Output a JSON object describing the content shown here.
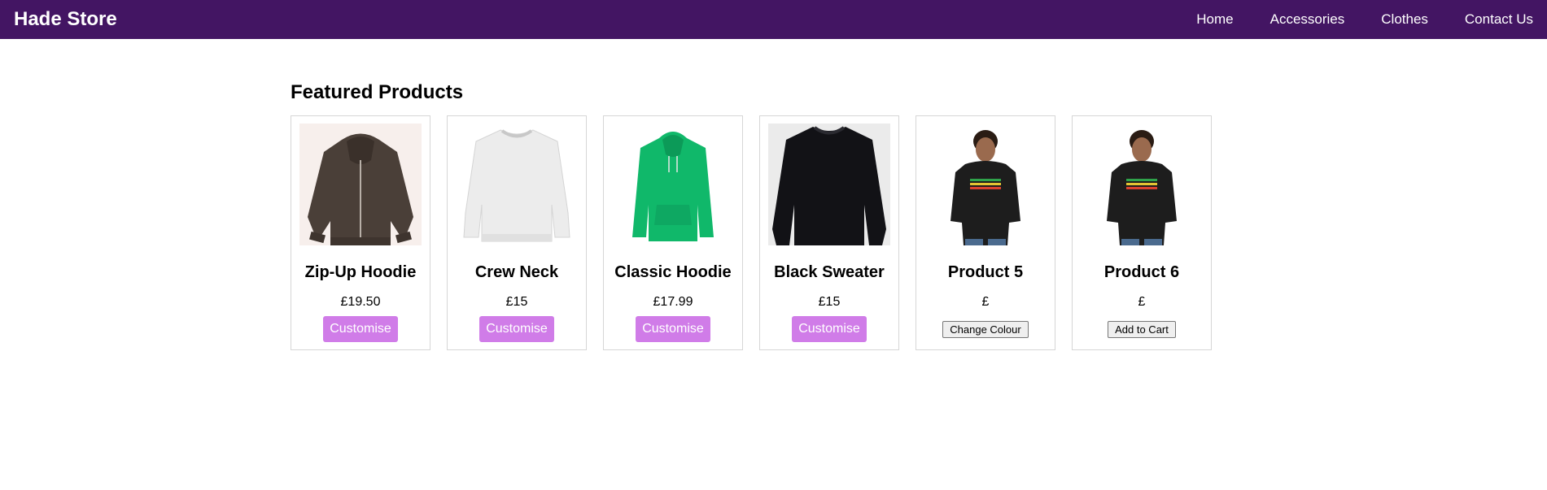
{
  "header": {
    "brand": "Hade Store",
    "nav": [
      "Home",
      "Accessories",
      "Clothes",
      "Contact Us"
    ],
    "background": "#431563"
  },
  "main": {
    "section_title": "Featured Products",
    "products": [
      {
        "name": "Zip-Up Hoodie",
        "price": "£19.50",
        "action": "Customise",
        "image": "brown-zip-hoodie",
        "color": "#4a3f38"
      },
      {
        "name": "Crew Neck",
        "price": "£15",
        "action": "Customise",
        "image": "white-crew-neck",
        "color": "#f2f2f2"
      },
      {
        "name": "Classic Hoodie",
        "price": "£17.99",
        "action": "Customise",
        "image": "green-hoodie",
        "color": "#10b86a"
      },
      {
        "name": "Black Sweater",
        "price": "£15",
        "action": "Customise",
        "image": "black-sweater",
        "color": "#121216"
      },
      {
        "name": "Product 5",
        "price": "£",
        "action": "Change Colour",
        "image": "habesha-hoodie-model",
        "color": "#1d1d1d"
      },
      {
        "name": "Product 6",
        "price": "£",
        "action": "Add to Cart",
        "image": "habesha-hoodie-model",
        "color": "#1d1d1d"
      }
    ],
    "customise_color": "#d07ce8"
  }
}
